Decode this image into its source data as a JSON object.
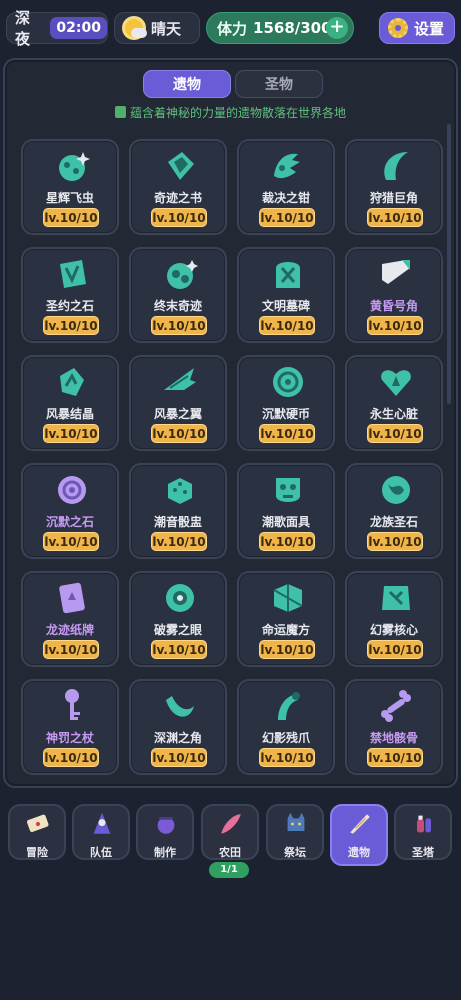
{
  "header": {
    "time_label": "深夜",
    "time_value": "02:00",
    "weather_icon": "sun-cloud-icon",
    "weather_label": "晴天",
    "stamina_label": "体力",
    "stamina_value": "1568/300",
    "stamina_add_icon": "plus-icon",
    "settings_icon": "gear-icon",
    "settings_label": "设置"
  },
  "tabs": [
    {
      "label": "遗物",
      "active": true
    },
    {
      "label": "圣物",
      "active": false
    }
  ],
  "subtitle": "蕴含着神秘的力量的遗物散落在世界各地",
  "relics": [
    {
      "name": "星辉飞虫",
      "level": "lv.10/10",
      "icon": "beetle-icon",
      "rare": false
    },
    {
      "name": "奇迹之书",
      "level": "lv.10/10",
      "icon": "book-icon",
      "rare": false
    },
    {
      "name": "裁决之钳",
      "level": "lv.10/10",
      "icon": "claw-icon",
      "rare": false
    },
    {
      "name": "狩猎巨角",
      "level": "lv.10/10",
      "icon": "horn-icon",
      "rare": false
    },
    {
      "name": "圣约之石",
      "level": "lv.10/10",
      "icon": "rune-stone-icon",
      "rare": false
    },
    {
      "name": "终末奇迹",
      "level": "lv.10/10",
      "icon": "swirl-orb-icon",
      "rare": false
    },
    {
      "name": "文明墓碑",
      "level": "lv.10/10",
      "icon": "tombstone-icon",
      "rare": false
    },
    {
      "name": "黄昏号角",
      "level": "lv.10/10",
      "icon": "war-horn-icon",
      "rare": true
    },
    {
      "name": "风暴结晶",
      "level": "lv.10/10",
      "icon": "crystal-icon",
      "rare": false
    },
    {
      "name": "风暴之翼",
      "level": "lv.10/10",
      "icon": "wing-icon",
      "rare": false
    },
    {
      "name": "沉默硬币",
      "level": "lv.10/10",
      "icon": "coin-icon",
      "rare": false
    },
    {
      "name": "永生心脏",
      "level": "lv.10/10",
      "icon": "heart-icon",
      "rare": false
    },
    {
      "name": "沉默之石",
      "level": "lv.10/10",
      "icon": "spiral-shell-icon",
      "rare": true
    },
    {
      "name": "潮音骰盅",
      "level": "lv.10/10",
      "icon": "dice-icon",
      "rare": false
    },
    {
      "name": "潮歌面具",
      "level": "lv.10/10",
      "icon": "mask-icon",
      "rare": false
    },
    {
      "name": "龙族圣石",
      "level": "lv.10/10",
      "icon": "dragon-stone-icon",
      "rare": false
    },
    {
      "name": "龙迹纸牌",
      "level": "lv.10/10",
      "icon": "card-icon",
      "rare": true
    },
    {
      "name": "破雾之眼",
      "level": "lv.10/10",
      "icon": "eye-icon",
      "rare": false
    },
    {
      "name": "命运魔方",
      "level": "lv.10/10",
      "icon": "cube-icon",
      "rare": false
    },
    {
      "name": "幻雾核心",
      "level": "lv.10/10",
      "icon": "core-rune-icon",
      "rare": false
    },
    {
      "name": "神罚之杖",
      "level": "lv.10/10",
      "icon": "key-staff-icon",
      "rare": true
    },
    {
      "name": "深渊之角",
      "level": "lv.10/10",
      "icon": "curved-horn-icon",
      "rare": false
    },
    {
      "name": "幻影残爪",
      "level": "lv.10/10",
      "icon": "talon-icon",
      "rare": false
    },
    {
      "name": "禁地骸骨",
      "level": "lv.10/10",
      "icon": "bone-icon",
      "rare": true
    }
  ],
  "nav": [
    {
      "label": "冒险",
      "icon": "scroll-map-icon",
      "active": false
    },
    {
      "label": "队伍",
      "icon": "mage-icon",
      "active": false
    },
    {
      "label": "制作",
      "icon": "cauldron-icon",
      "active": false
    },
    {
      "label": "农田",
      "icon": "feather-icon",
      "active": false,
      "badge": "1/1"
    },
    {
      "label": "祭坛",
      "icon": "cat-icon",
      "active": false
    },
    {
      "label": "遗物",
      "icon": "shell-icon",
      "active": true
    },
    {
      "label": "圣塔",
      "icon": "potion-icon",
      "active": false
    }
  ],
  "colors": {
    "accent": "#6a5bd6",
    "stamina": "#2c7a5b",
    "level_badge": "#f0b54a",
    "icon_teal": "#3ec1a6",
    "rare_name": "#c69af2"
  }
}
